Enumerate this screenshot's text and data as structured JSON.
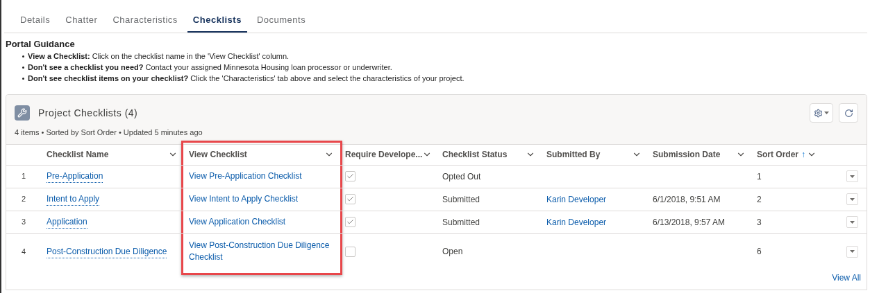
{
  "tabs": [
    {
      "label": "Details",
      "selected": false
    },
    {
      "label": "Chatter",
      "selected": false
    },
    {
      "label": "Characteristics",
      "selected": false
    },
    {
      "label": "Checklists",
      "selected": true
    },
    {
      "label": "Documents",
      "selected": false
    }
  ],
  "guidance": {
    "title": "Portal Guidance",
    "items": [
      "**View a Checklist:** Click on the checklist name in the 'View Checklist' column.",
      "**Don't see a checklist you need?** Contact your assigned Minnesota Housing loan processor or underwriter.",
      "**Don't see checklist items on your checklist?** Click the 'Characteristics' tab above and select the characteristics of your project."
    ]
  },
  "card": {
    "title": "Project Checklists (4)",
    "meta": "4 items • Sorted by Sort Order • Updated 5 minutes ago",
    "footer_link": "View All"
  },
  "columns": [
    {
      "label": "Checklist Name",
      "highlighted": false
    },
    {
      "label": "View Checklist",
      "highlighted": true
    },
    {
      "label": "Require Develope...",
      "highlighted": false
    },
    {
      "label": "Checklist Status",
      "highlighted": false
    },
    {
      "label": "Submitted By",
      "highlighted": false
    },
    {
      "label": "Submission Date",
      "highlighted": false
    },
    {
      "label": "Sort Order",
      "highlighted": false,
      "sort": "↑"
    }
  ],
  "rows": [
    {
      "number": "1",
      "name": "Pre-Application",
      "view": "View Pre-Application Checklist",
      "require": true,
      "status": "Opted Out",
      "submitted_by": "",
      "date": "",
      "sort_order": "1"
    },
    {
      "number": "2",
      "name": "Intent to Apply",
      "view": "View Intent to Apply Checklist",
      "require": true,
      "status": "Submitted",
      "submitted_by": "Karin Developer",
      "date": "6/1/2018, 9:51 AM",
      "sort_order": "2"
    },
    {
      "number": "3",
      "name": "Application",
      "view": "View Application Checklist",
      "require": true,
      "status": "Submitted",
      "submitted_by": "Karin Developer",
      "date": "6/13/2018, 9:57 AM",
      "sort_order": "3"
    },
    {
      "number": "4",
      "name": "Post-Construction Due Diligence",
      "view": "View Post-Construction Due Diligence Checklist",
      "require": false,
      "status": "Open",
      "submitted_by": "",
      "date": "",
      "sort_order": "6"
    }
  ]
}
